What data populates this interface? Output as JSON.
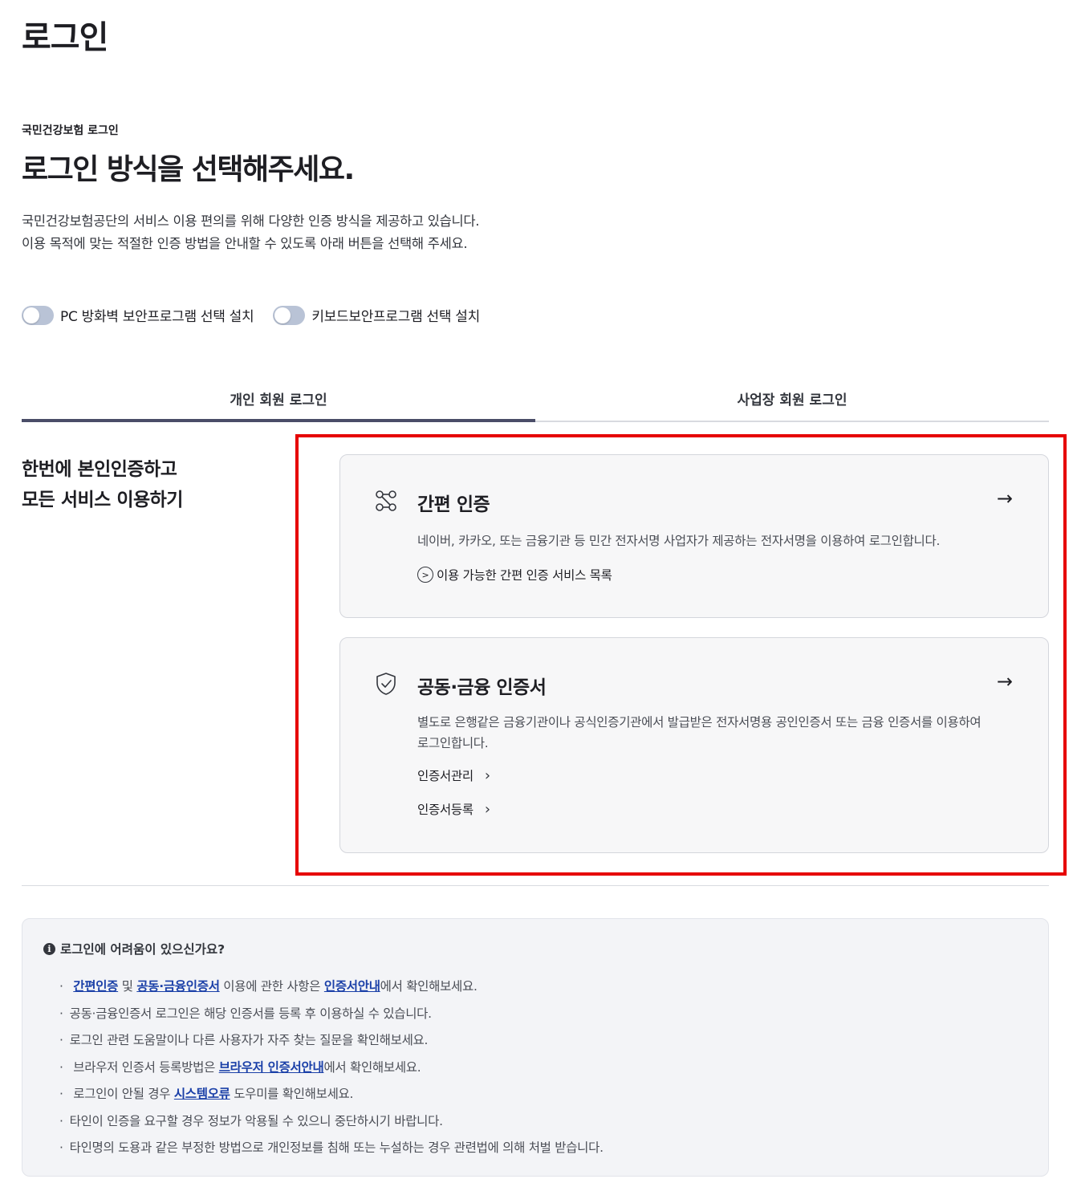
{
  "page": {
    "title": "로그인"
  },
  "intro": {
    "eyebrow": "국민건강보험 로그인",
    "headline": "로그인 방식을 선택해주세요.",
    "desc_line1": "국민건강보험공단의 서비스 이용 편의를 위해 다양한 인증 방식을 제공하고 있습니다.",
    "desc_line2": "이용 목적에 맞는 적절한 인증 방법을 안내할 수 있도록 아래 버튼을 선택해 주세요."
  },
  "toggles": [
    {
      "label": "PC 방화벽 보안프로그램 선택 설치",
      "on": false
    },
    {
      "label": "키보드보안프로그램 선택 설치",
      "on": false
    }
  ],
  "tabs": [
    {
      "label": "개인 회원 로그인",
      "active": true
    },
    {
      "label": "사업장 회원 로그인",
      "active": false
    }
  ],
  "side_heading": {
    "line1": "한번에 본인인증하고",
    "line2": "모든 서비스 이용하기"
  },
  "cards": {
    "simple": {
      "title": "간편 인증",
      "arrow": "→",
      "desc": "네이버, 카카오, 또는 금융기관 등 민간 전자서명 사업자가 제공하는 전자서명을 이용하여 로그인합니다.",
      "link": "이용 가능한 간편 인증 서비스 목록"
    },
    "cert": {
      "title": "공동·금융 인증서",
      "arrow": "→",
      "desc": "별도로 은행같은 금융기관이나 공식인증기관에서 발급받은 전자서명용 공인인증서 또는 금융 인증서를 이용하여 로그인합니다.",
      "link_manage": "인증서관리",
      "link_register": "인증서등록"
    }
  },
  "help": {
    "title": "로그인에 어려움이 있으신가요?",
    "l1": {
      "a": "간편인증",
      "b": " 및 ",
      "c": "공동·금융인증서",
      "d": " 이용에 관한 사항은 ",
      "e": "인증서안내",
      "f": "에서 확인해보세요."
    },
    "l2": "공동·금융인증서 로그인은 해당 인증서를 등록 후 이용하실 수 있습니다.",
    "l3": "로그인 관련 도움말이나 다른 사용자가 자주 찾는 질문을 확인해보세요.",
    "l4": {
      "a": "브라우저 인증서 등록방법은 ",
      "b": "브라우저 인증서안내",
      "c": "에서 확인해보세요."
    },
    "l5": {
      "a": "로그인이 안될 경우 ",
      "b": "시스템오류",
      "c": " 도우미를 확인해보세요."
    },
    "l6": "타인이 인증을 요구할 경우 정보가 악용될 수 있으니 중단하시기 바랍니다.",
    "l7": "타인명의 도용과 같은 부정한 방법으로 개인정보를 침해 또는 누설하는 경우 관련법에 의해 처벌 받습니다."
  },
  "colors": {
    "highlight": "#e60000",
    "link": "#1b40a8",
    "tab_active": "#4a4d68",
    "toggle_off": "#b9c3d6"
  }
}
